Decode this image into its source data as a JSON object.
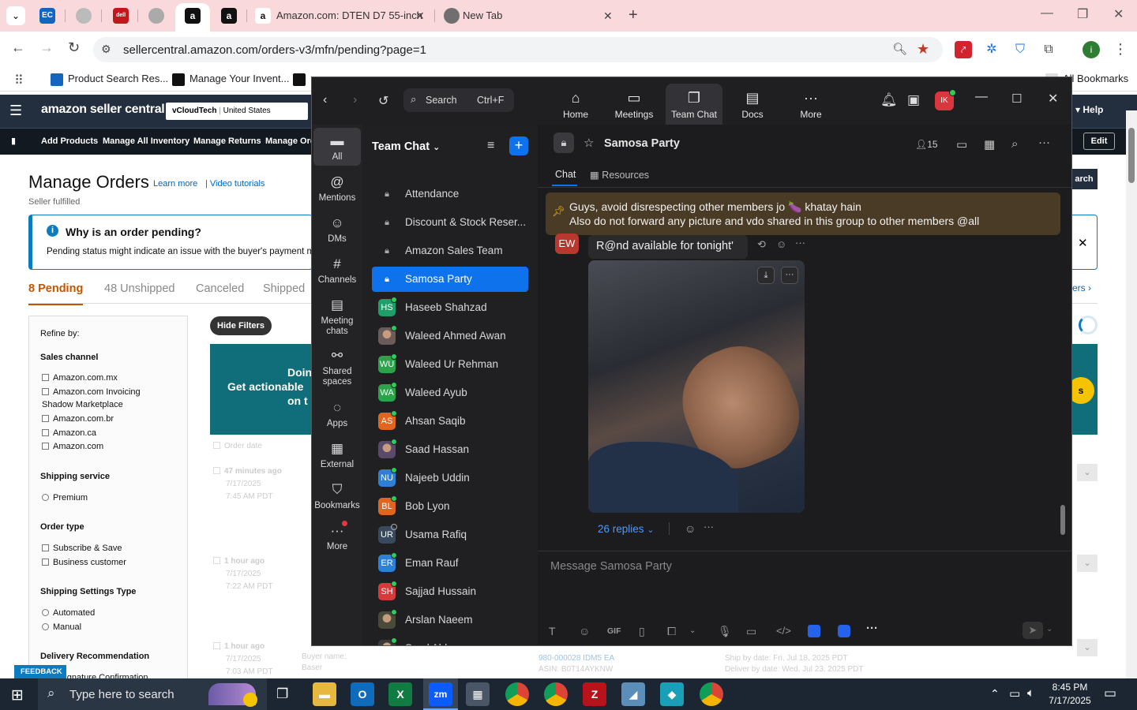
{
  "browser": {
    "tabs": [
      {
        "label": "",
        "fav": "EC"
      },
      {
        "label": "",
        "fav": ""
      },
      {
        "label": "",
        "fav": "dell"
      },
      {
        "label": "",
        "fav": ""
      },
      {
        "label": "",
        "fav": "a"
      },
      {
        "label": "",
        "fav": "a"
      },
      {
        "label": "Amazon.com: DTEN D7 55-inch",
        "fav": "a"
      },
      {
        "label": "New Tab",
        "fav": ""
      }
    ],
    "url": "sellercentral.amazon.com/orders-v3/mfn/pending?page=1",
    "bookmarks": [
      "Product Search Res...",
      "Manage Your Invent...",
      "All Bookmarks"
    ]
  },
  "seller": {
    "logo": "amazon seller central",
    "account": "vCloudTech",
    "marketplace": "United States",
    "help": "Help",
    "nav": [
      "Add Products",
      "Manage All Inventory",
      "Manage Returns",
      "Manage Ord"
    ],
    "edit": "Edit",
    "title": "Manage Orders",
    "learn_more": "Learn more",
    "video_tutorials": "Video tutorials",
    "subtitle": "Seller fulfilled",
    "banner_title": "Why is an order pending?",
    "banner_text": "Pending status might indicate an issue with the buyer's payment m",
    "tabs": [
      {
        "count": "8",
        "label": "Pending"
      },
      {
        "count": "48",
        "label": "Unshipped"
      },
      {
        "count": "",
        "label": "Canceled"
      },
      {
        "count": "",
        "label": "Shipped"
      }
    ],
    "hide_filters": "Hide Filters",
    "promo": [
      "Doin",
      "Get actionable",
      "on t"
    ],
    "refine_by": "Refine by:",
    "sales_channel": "Sales channel",
    "channels": [
      "Amazon.com.mx",
      "Amazon.com Invoicing",
      "Shadow Marketplace",
      "Amazon.com.br",
      "Amazon.ca",
      "Amazon.com"
    ],
    "shipping_service": "Shipping service",
    "premium": "Premium",
    "order_type": "Order type",
    "order_types": [
      "Subscribe & Save",
      "Business customer"
    ],
    "ship_settings": "Shipping Settings Type",
    "ship_types": [
      "Automated",
      "Manual"
    ],
    "delivery": "Delivery Recommendation",
    "delivery_sub": "Signature Confirmation",
    "order_date": "Order date",
    "orders": [
      {
        "age": "47 minutes ago",
        "date": "7/17/2025",
        "time": "7:45 AM PDT"
      },
      {
        "age": "1 hour ago",
        "date": "7/17/2025",
        "time": "7:22 AM PDT"
      },
      {
        "age": "1 hour ago",
        "date": "7/17/2025",
        "time": "7:03 AM PDT"
      }
    ],
    "feedback": "FEEDBACK",
    "search_btn": "arch",
    "orders_link": "ers",
    "bottom_row": {
      "order_id": "980-000028 IDM5 EA",
      "asin": "ASIN: B0T14AYKNW",
      "ship_by": "Ship by date: Fri, Jul 18, 2025 PDT",
      "deliver_by": "Deliver by date: Wed, Jul 23, 2025 PDT",
      "buyer": "Buyer name:",
      "buyer2": "Baser"
    }
  },
  "zoom": {
    "search_label": "Search",
    "search_shortcut": "Ctrl+F",
    "top_nav": [
      "Home",
      "Meetings",
      "Team Chat",
      "Docs",
      "More"
    ],
    "avatar": "IK",
    "rail": [
      "All",
      "Mentions",
      "DMs",
      "Channels",
      "Meeting chats",
      "Shared spaces",
      "Apps",
      "External",
      "Bookmarks",
      "More"
    ],
    "list_title": "Team Chat",
    "channels": [
      {
        "name": "Attendance",
        "kind": "lock",
        "color": "#4a4a4e"
      },
      {
        "name": "Discount & Stock Reser...",
        "kind": "lock",
        "color": "#4a4a4e"
      },
      {
        "name": "Amazon Sales Team",
        "kind": "lock",
        "color": "#4a4a4e"
      },
      {
        "name": "Samosa Party",
        "kind": "lock",
        "color": "#0e72ed"
      },
      {
        "name": "Haseeb Shahzad",
        "kind": "HS",
        "color": "#1f9e6a"
      },
      {
        "name": "Waleed Ahmed Awan",
        "kind": "photo",
        "color": "#6b5b5b"
      },
      {
        "name": "Waleed Ur Rehman",
        "kind": "WU",
        "color": "#2aa34a"
      },
      {
        "name": "Waleed Ayub",
        "kind": "WA",
        "color": "#2aa34a"
      },
      {
        "name": "Ahsan Saqib",
        "kind": "AS",
        "color": "#e0651e"
      },
      {
        "name": "Saad Hassan",
        "kind": "photo",
        "color": "#5a4a6a"
      },
      {
        "name": "Najeeb Uddin",
        "kind": "NU",
        "color": "#2e7fd6"
      },
      {
        "name": "Bob Lyon",
        "kind": "BL",
        "color": "#e0651e"
      },
      {
        "name": "Usama Rafiq",
        "kind": "UR",
        "color": "#3a4a5e"
      },
      {
        "name": "Eman Rauf",
        "kind": "ER",
        "color": "#2e7fd6"
      },
      {
        "name": "Sajjad Hussain",
        "kind": "SH",
        "color": "#d63a3a"
      },
      {
        "name": "Arslan Naeem",
        "kind": "photo",
        "color": "#4a4a3a"
      },
      {
        "name": "Syed Abbas",
        "kind": "photo",
        "color": "#3a3a3a"
      }
    ],
    "chat_title": "Samosa Party",
    "member_count": "15",
    "chat_tabs": [
      "Chat",
      "Resources"
    ],
    "pinned_1": "Guys, avoid disrespecting other members jo 🍆 khatay hain",
    "pinned_2": "Also do not forward any picture and vdo shared in this group to other members @all",
    "sender_initials": "EW",
    "message": "R@nd available for tonight'",
    "replies": "26 replies",
    "composer_placeholder": "Message Samosa Party",
    "gif": "GIF"
  },
  "taskbar": {
    "search": "Type here to search",
    "time": "8:45 PM",
    "date": "7/17/2025"
  }
}
